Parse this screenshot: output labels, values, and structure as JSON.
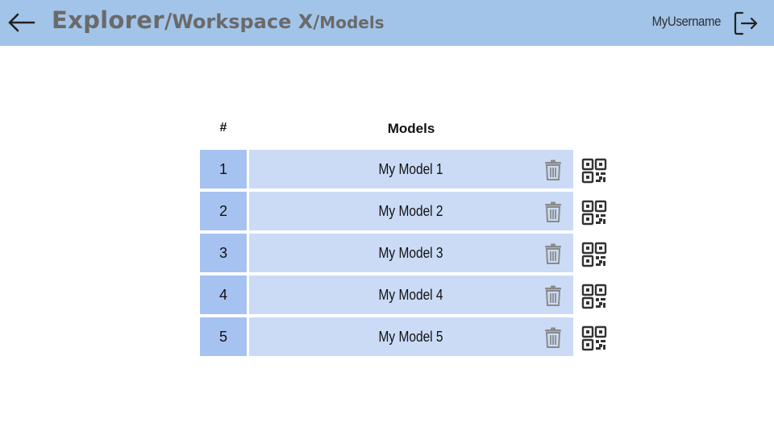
{
  "header": {
    "breadcrumb": {
      "root": "Explorer",
      "workspace": "Workspace X",
      "page": "Models",
      "separator": "/"
    },
    "username": "MyUsername",
    "icons": {
      "back": "arrow-left-icon",
      "logout": "logout-icon"
    },
    "background_color": "#a2c4e9"
  },
  "table": {
    "columns": {
      "number": "#",
      "models": "Models"
    },
    "rows": [
      {
        "number": "1",
        "name": "My Model 1"
      },
      {
        "number": "2",
        "name": "My Model 2"
      },
      {
        "number": "3",
        "name": "My Model 3"
      },
      {
        "number": "4",
        "name": "My Model 4"
      },
      {
        "number": "5",
        "name": "My Model 5"
      }
    ],
    "row_icons": {
      "delete": "trash-icon",
      "qr": "qr-code-icon"
    },
    "colors": {
      "number_cell": "#a6c2f0",
      "name_cell": "#cbdbf6"
    }
  }
}
